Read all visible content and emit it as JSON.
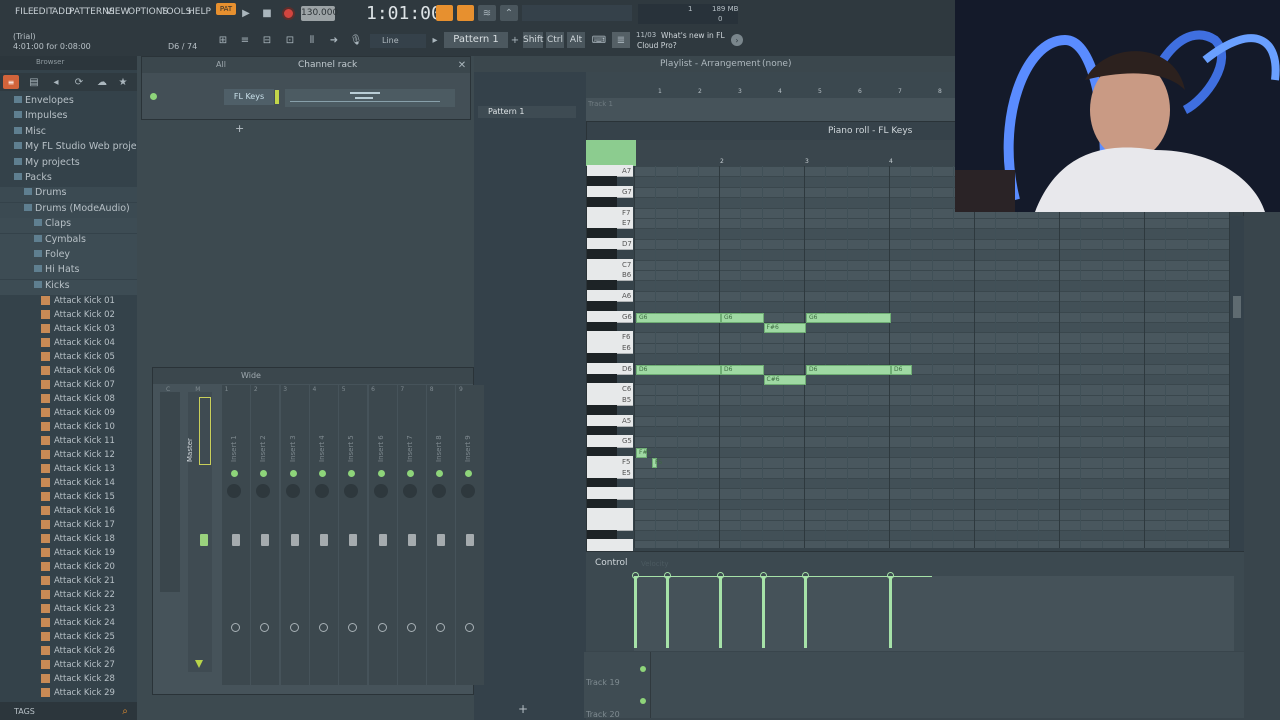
{
  "menu": [
    "FILE",
    "EDIT",
    "ADD",
    "PATTERNS",
    "VIEW",
    "OPTIONS",
    "TOOLS",
    "HELP"
  ],
  "hint": {
    "line1": "(Trial)",
    "line2": "4:01:00 for 0:08:00",
    "pos": "D6 / 74"
  },
  "transport": {
    "pat": "PAT",
    "tempo": "130.000",
    "time": "1:01:00",
    "snap": "Line",
    "pattern": "Pattern 1"
  },
  "keys": {
    "shift": "Shift",
    "ctrl": "Ctrl",
    "alt": "Alt"
  },
  "news": {
    "date": "11/03",
    "line1": "What's new in FL",
    "line2": "Cloud Pro?"
  },
  "cpu": {
    "mem": "189 MB",
    "val1": "1",
    "val2": "0"
  },
  "browser": {
    "title": "Browser",
    "tags": "TAGS",
    "folders": [
      "Envelopes",
      "Impulses",
      "Misc",
      "My FL Studio Web projects",
      "My projects",
      "Packs"
    ],
    "pack_items": [
      "Drums",
      "Drums (ModeAudio)"
    ],
    "sub": [
      "Claps",
      "Cymbals",
      "Foley",
      "Hi Hats",
      "Kicks"
    ],
    "files": [
      "Attack Kick 01",
      "Attack Kick 02",
      "Attack Kick 03",
      "Attack Kick 04",
      "Attack Kick 05",
      "Attack Kick 06",
      "Attack Kick 07",
      "Attack Kick 08",
      "Attack Kick 09",
      "Attack Kick 10",
      "Attack Kick 11",
      "Attack Kick 12",
      "Attack Kick 13",
      "Attack Kick 14",
      "Attack Kick 15",
      "Attack Kick 16",
      "Attack Kick 17",
      "Attack Kick 18",
      "Attack Kick 19",
      "Attack Kick 20",
      "Attack Kick 21",
      "Attack Kick 22",
      "Attack Kick 23",
      "Attack Kick 24",
      "Attack Kick 25",
      "Attack Kick 26",
      "Attack Kick 27",
      "Attack Kick 28",
      "Attack Kick 29"
    ]
  },
  "channel_rack": {
    "title": "Channel rack",
    "filter": "All",
    "channel": "FL Keys",
    "add": "+"
  },
  "playlist": {
    "title": "Playlist - Arrangement",
    "pattern": "(none)",
    "pattern_item": "Pattern 1",
    "track1": "Track 1",
    "track19": "Track 19",
    "track20": "Track 20",
    "bar_numbers": [
      "1",
      "2",
      "3",
      "4",
      "5",
      "6",
      "7",
      "8"
    ],
    "add": "+"
  },
  "piano_roll": {
    "title": "Piano roll - FL Keys",
    "control": "Control",
    "control_target": "Velocity",
    "bars": [
      "2",
      "3",
      "4"
    ],
    "key_labels": [
      "A7",
      "G7",
      "F7",
      "E7",
      "D7",
      "C7",
      "B6",
      "A6",
      "G6",
      "F6",
      "E6",
      "D6",
      "C6",
      "B5",
      "A5",
      "G5",
      "F5",
      "E5"
    ],
    "notes": [
      {
        "label": "G6"
      },
      {
        "label": "G6"
      },
      {
        "label": "F#6"
      },
      {
        "label": "G6"
      },
      {
        "label": "D6"
      },
      {
        "label": "D6"
      },
      {
        "label": "C#6"
      },
      {
        "label": "D6"
      },
      {
        "label": "D6"
      },
      {
        "label": "F#5"
      },
      {
        "label": "F5"
      }
    ]
  },
  "mixer": {
    "mode": "Wide",
    "master": "Master",
    "inserts": [
      "Insert 1",
      "Insert 2",
      "Insert 3",
      "Insert 4",
      "Insert 5",
      "Insert 6",
      "Insert 7",
      "Insert 8",
      "Insert 9"
    ],
    "numbers": [
      "C",
      "M",
      "1",
      "2",
      "3",
      "4",
      "5",
      "6",
      "7",
      "8",
      "9"
    ]
  }
}
